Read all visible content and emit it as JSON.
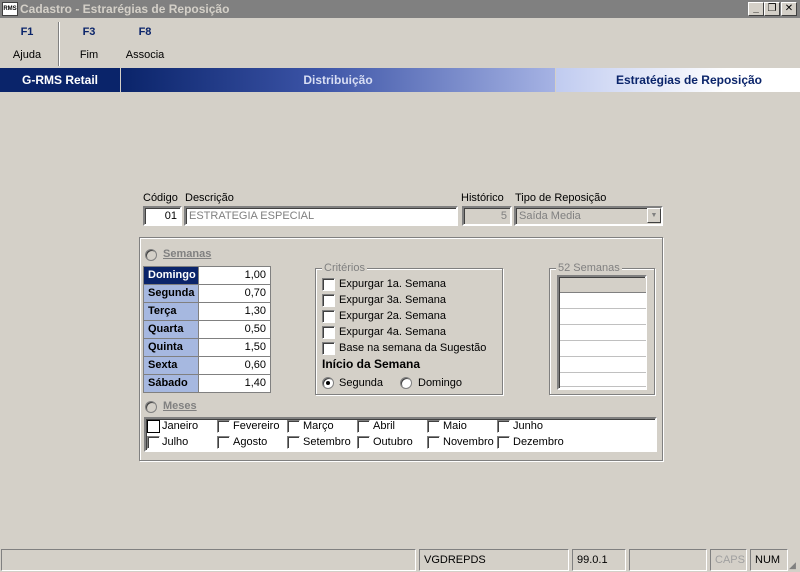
{
  "window": {
    "icon_text": "RMS",
    "title": "Cadastro - Estrarégias de Reposição",
    "minimize_glyph": "_",
    "restore_glyph": "❐",
    "close_glyph": "✕"
  },
  "toolbar": {
    "items": [
      {
        "key": "F1",
        "label": "Ajuda"
      },
      {
        "key": "F3",
        "label": "Fim"
      },
      {
        "key": "F8",
        "label": "Associa"
      }
    ]
  },
  "banner": {
    "left": "G-RMS Retail",
    "middle": "Distribuição",
    "right": "Estratégias de Reposição"
  },
  "form": {
    "codigo_label": "Código",
    "codigo_value": "01",
    "descricao_label": "Descrição",
    "descricao_value": "ESTRATEGIA ESPECIAL",
    "historico_label": "Histórico",
    "historico_value": "5",
    "tipo_label": "Tipo de Reposição",
    "tipo_value": "Saída Media",
    "combo_arrow": "▼"
  },
  "semanas": {
    "label": "Semanas",
    "days": [
      {
        "name": "Domingo",
        "value": "1,00"
      },
      {
        "name": "Segunda",
        "value": "0,70"
      },
      {
        "name": "Terça",
        "value": "1,30"
      },
      {
        "name": "Quarta",
        "value": "0,50"
      },
      {
        "name": "Quinta",
        "value": "1,50"
      },
      {
        "name": "Sexta",
        "value": "0,60"
      },
      {
        "name": "Sábado",
        "value": "1,40"
      }
    ]
  },
  "criterios": {
    "label": "Critérios",
    "options": [
      "Expurgar 1a. Semana",
      "Expurgar 3a. Semana",
      "Expurgar 2a. Semana",
      "Expurgar 4a. Semana",
      "Base na semana da Sugestão"
    ],
    "inicio_label": "Início da Semana",
    "inicio_options": [
      "Segunda",
      "Domingo"
    ],
    "inicio_selected": "Segunda"
  },
  "semanas52": {
    "label": "52 Semanas"
  },
  "meses": {
    "label": "Meses",
    "months": [
      "Janeiro",
      "Fevereiro",
      "Março",
      "Abril",
      "Maio",
      "Junho",
      "Julho",
      "Agosto",
      "Setembro",
      "Outubro",
      "Novembro",
      "Dezembro"
    ]
  },
  "statusbar": {
    "program": "VGDREPDS",
    "version": "99.0.1",
    "caps": "CAPS",
    "num": "NUM"
  }
}
